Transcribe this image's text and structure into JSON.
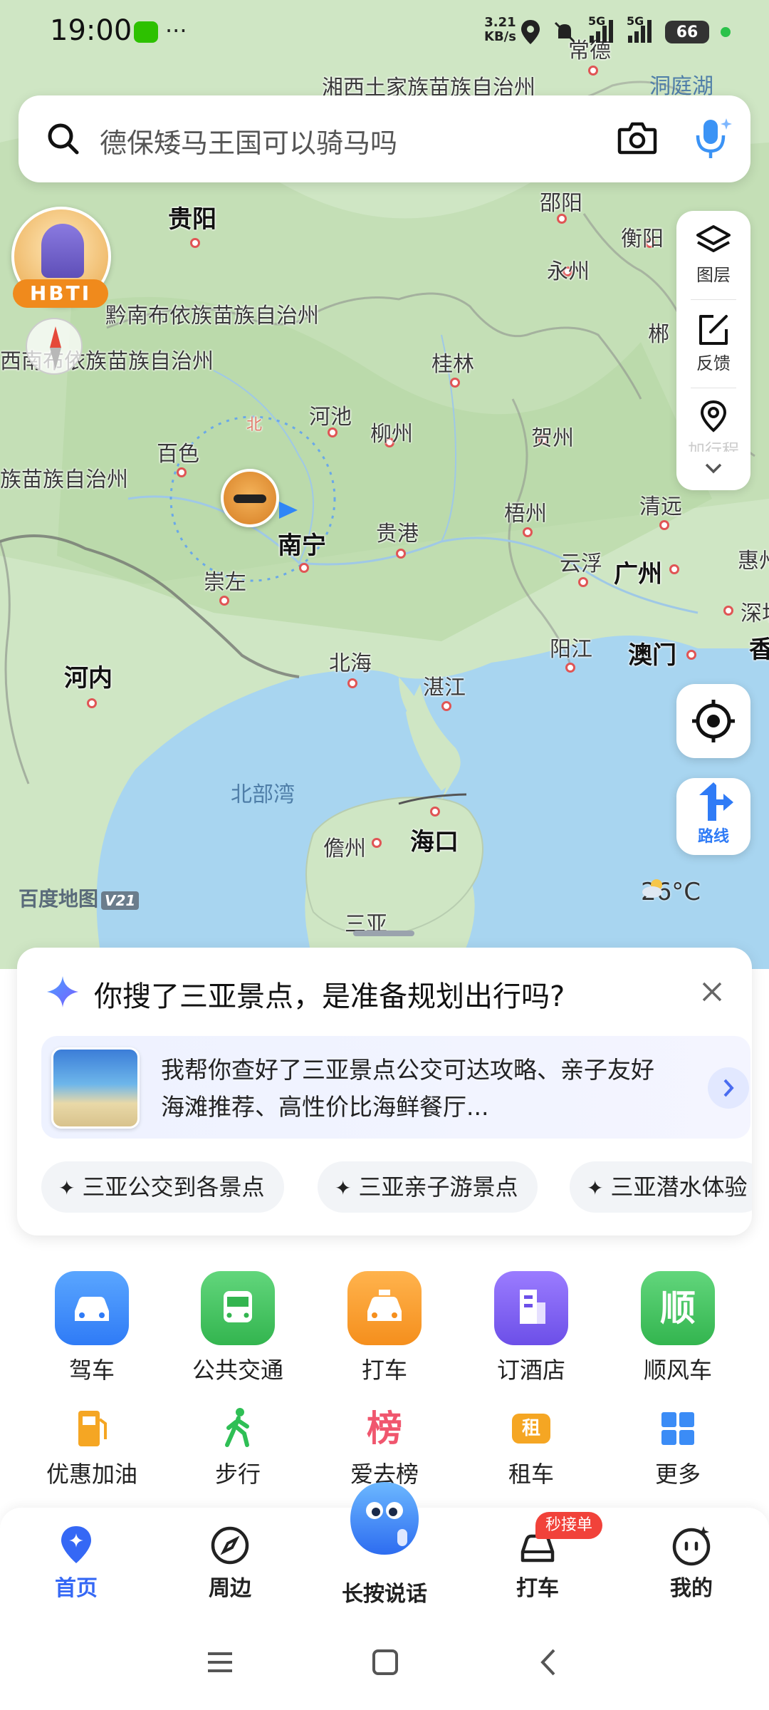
{
  "status_bar": {
    "time": "19:00",
    "net_speed_value": "3.21",
    "net_speed_unit": "KB/s",
    "sim1": "5G",
    "sim2": "5G",
    "battery": "66"
  },
  "search": {
    "placeholder": "德保矮马王国可以骑马吗"
  },
  "map": {
    "labels": {
      "changde": "常德",
      "xiangxi": "湘西土家族苗族自治州",
      "dongting": "洞庭湖",
      "guiyang": "贵阳",
      "shaoyang": "邵阳",
      "hengyang": "衡阳",
      "yongzhou": "永州",
      "qiannan": "黔南布依族苗族自治州",
      "qianxinan": "西南布依族苗族自治州",
      "guilin": "桂林",
      "chenzhou": "郴",
      "hechi": "河池",
      "liuzhou": "柳州",
      "hezhou": "贺州",
      "baise": "百色",
      "wenshan": "族苗族自治州",
      "wuzhou": "梧州",
      "qingyuan": "清远",
      "nanning": "南宁",
      "guigang": "贵港",
      "yunfu": "云浮",
      "guangzhou": "广州",
      "huizhou": "惠州",
      "chongzuo": "崇左",
      "shenzhen": "深圳",
      "hanoi": "河内",
      "beihai": "北海",
      "yangjiang": "阳江",
      "macau": "澳门",
      "hongkong": "香",
      "zhanjiang": "湛江",
      "gulf": "北部湾",
      "danzhou": "儋州",
      "haikou": "海口",
      "sanya": "三亚",
      "north": "北"
    },
    "avatar_label": "HBTI",
    "logo": "百度地图",
    "logo_version": "V21",
    "weather_temp": "26°C"
  },
  "side_panel": {
    "layers": "图层",
    "feedback": "反馈",
    "more": "加行程"
  },
  "route_button": "路线",
  "suggestion_card": {
    "title": "你搜了三亚景点，是准备规划出行吗?",
    "ai_text": "我帮你查好了三亚景点公交可达攻略、亲子友好海滩推荐、高性价比海鲜餐厅...",
    "chips": [
      "三亚公交到各景点",
      "三亚亲子游景点",
      "三亚潜水体验"
    ]
  },
  "quick_grid": {
    "row1": [
      {
        "label": "驾车",
        "color": "#3b8cf6"
      },
      {
        "label": "公共交通",
        "color": "#3cc35a"
      },
      {
        "label": "打车",
        "color": "#f5a23a"
      },
      {
        "label": "订酒店",
        "color": "#7b5cf0"
      },
      {
        "label": "顺风车",
        "color": "#3cc35a",
        "glyph": "顺"
      }
    ],
    "row2": [
      {
        "label": "优惠加油"
      },
      {
        "label": "步行"
      },
      {
        "label": "爱去榜",
        "glyph": "榜"
      },
      {
        "label": "租车",
        "glyph": "租"
      },
      {
        "label": "更多"
      }
    ]
  },
  "bottom_nav": {
    "home": "首页",
    "nearby": "周边",
    "voice": "长按说话",
    "taxi": "打车",
    "taxi_badge": "秒接单",
    "me": "我的"
  }
}
